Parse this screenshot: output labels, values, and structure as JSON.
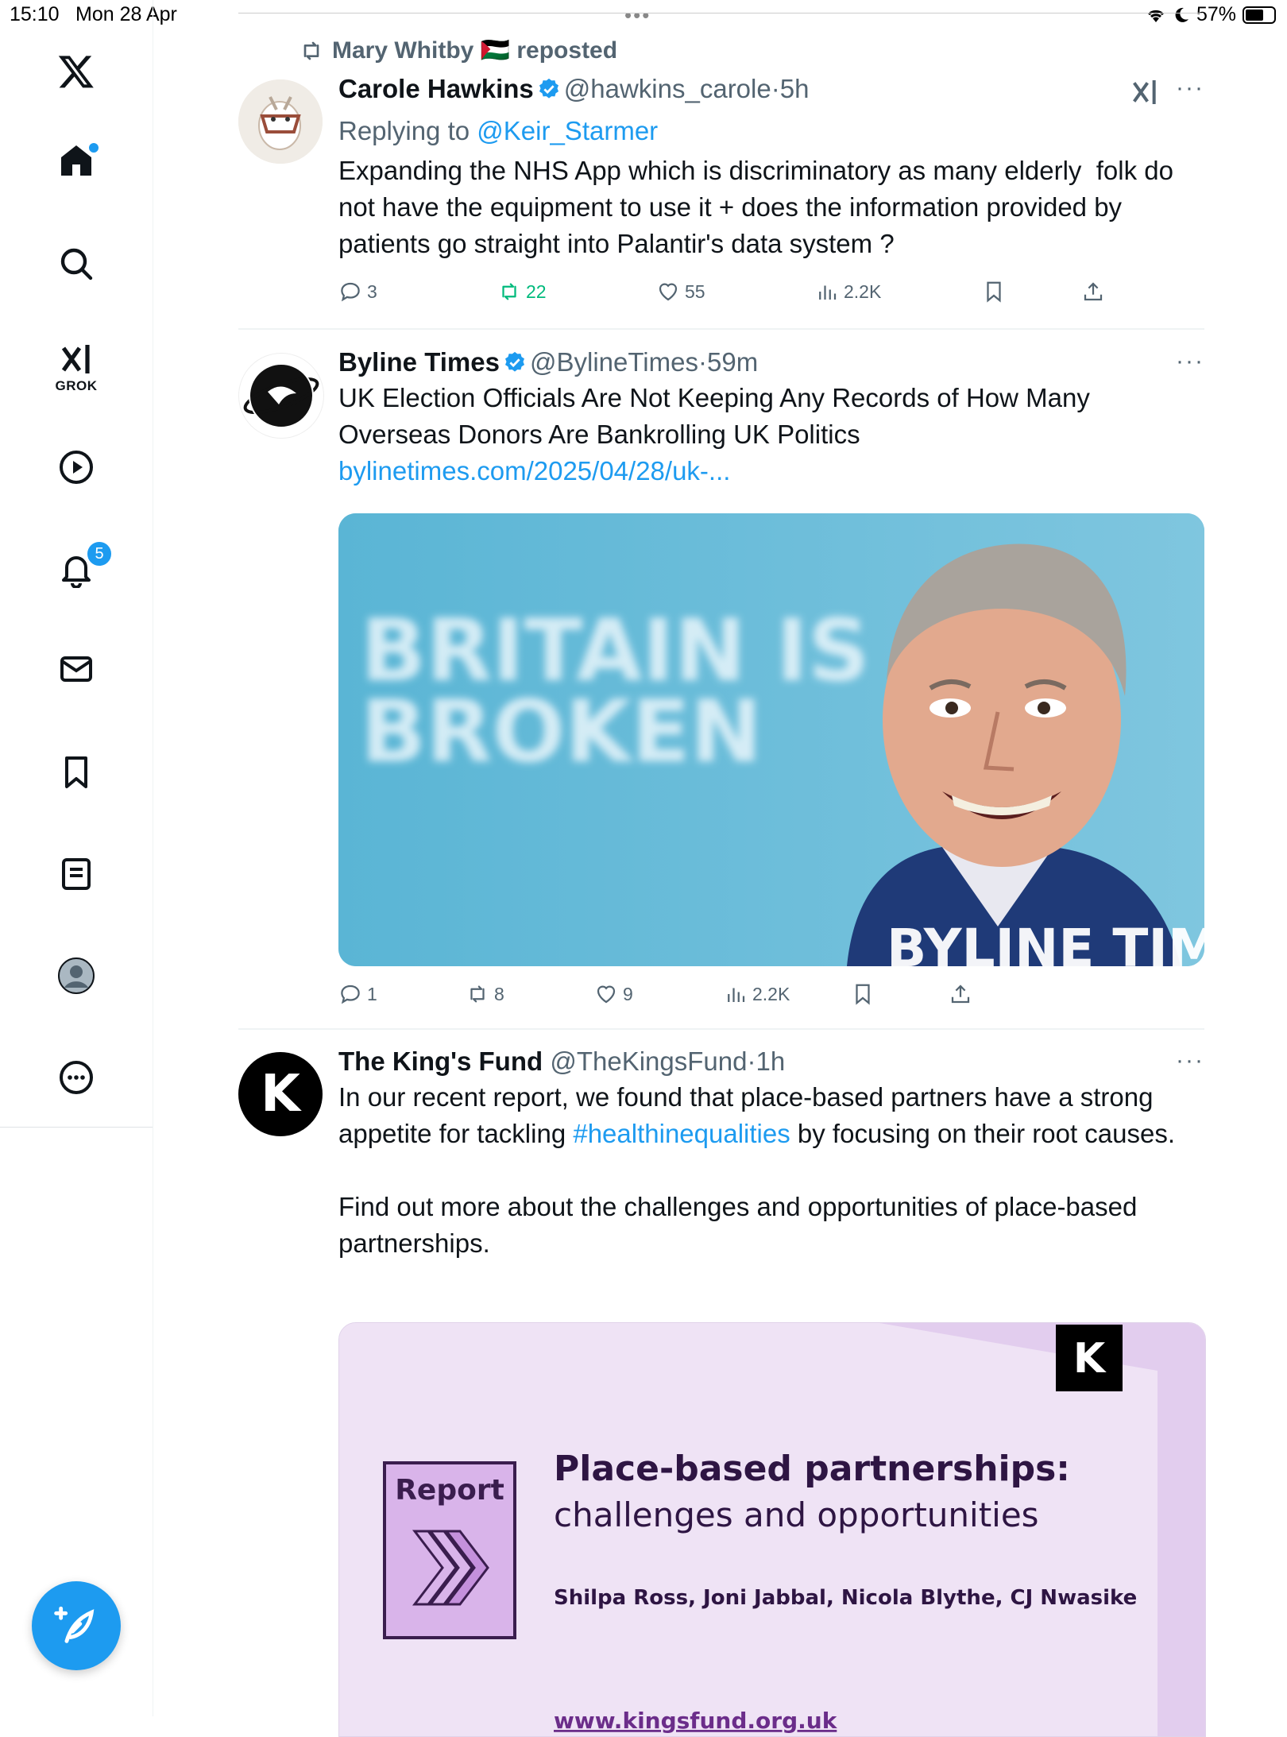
{
  "status_bar": {
    "time": "15:10",
    "date": "Mon 28 Apr",
    "battery": "57%",
    "dots": "•••"
  },
  "sidebar": {
    "items": [
      {
        "name": "x-logo"
      },
      {
        "name": "home",
        "dot": true
      },
      {
        "name": "search"
      },
      {
        "name": "grok",
        "label": "GROK"
      },
      {
        "name": "video"
      },
      {
        "name": "notifications",
        "badge": "5"
      },
      {
        "name": "messages"
      },
      {
        "name": "bookmarks"
      },
      {
        "name": "lists"
      },
      {
        "name": "profile"
      },
      {
        "name": "more"
      }
    ]
  },
  "feed": {
    "post1": {
      "repost_by": "Mary Whitby 🇵🇸 reposted",
      "name": "Carole Hawkins",
      "handle": "@hawkins_carole",
      "time": "5h",
      "replying_prefix": "Replying to ",
      "replying_to": "@Keir_Starmer",
      "text": "Expanding the NHS App which is discriminatory as many elderly  folk do not have the equipment to use it + does the information provided by patients go straight into Palantir's data system ?",
      "replies": "3",
      "reposts": "22",
      "likes": "55",
      "views": "2.2K"
    },
    "post2": {
      "name": "Byline Times",
      "handle": "@BylineTimes",
      "time": "59m",
      "text": "UK Election Officials Are Not Keeping Any Records of How Many Overseas Donors Are Bankrolling UK Politics ",
      "link": "bylinetimes.com/2025/04/28/uk-...",
      "image_text_1": "BRITAIN IS",
      "image_text_2": "BROKEN",
      "image_watermark": "BYLINE TIMES",
      "replies": "1",
      "reposts": "8",
      "likes": "9",
      "views": "2.2K"
    },
    "post3": {
      "name": "The King's Fund",
      "handle": "@TheKingsFund",
      "time": "1h",
      "text_a": "In our recent report, we found that place-based partners have a strong appetite for tackling ",
      "hashtag": "#healthinequalities",
      "text_b": " by focusing on their root causes.",
      "text_c": "Find out more about the challenges and opportunities of place-based partnerships.",
      "card": {
        "logo": "K",
        "report_label": "Report",
        "title": "Place-based partnerships:",
        "subtitle": "challenges and opportunities",
        "authors": "Shilpa Ross, Joni Jabbal, Nicola Blythe, CJ Nwasike",
        "url": "www.kingsfund.org.uk"
      }
    }
  },
  "colors": {
    "accent": "#1d9bf0",
    "repost_green": "#00ba7c",
    "text": "#0f1419",
    "muted": "#536471"
  }
}
